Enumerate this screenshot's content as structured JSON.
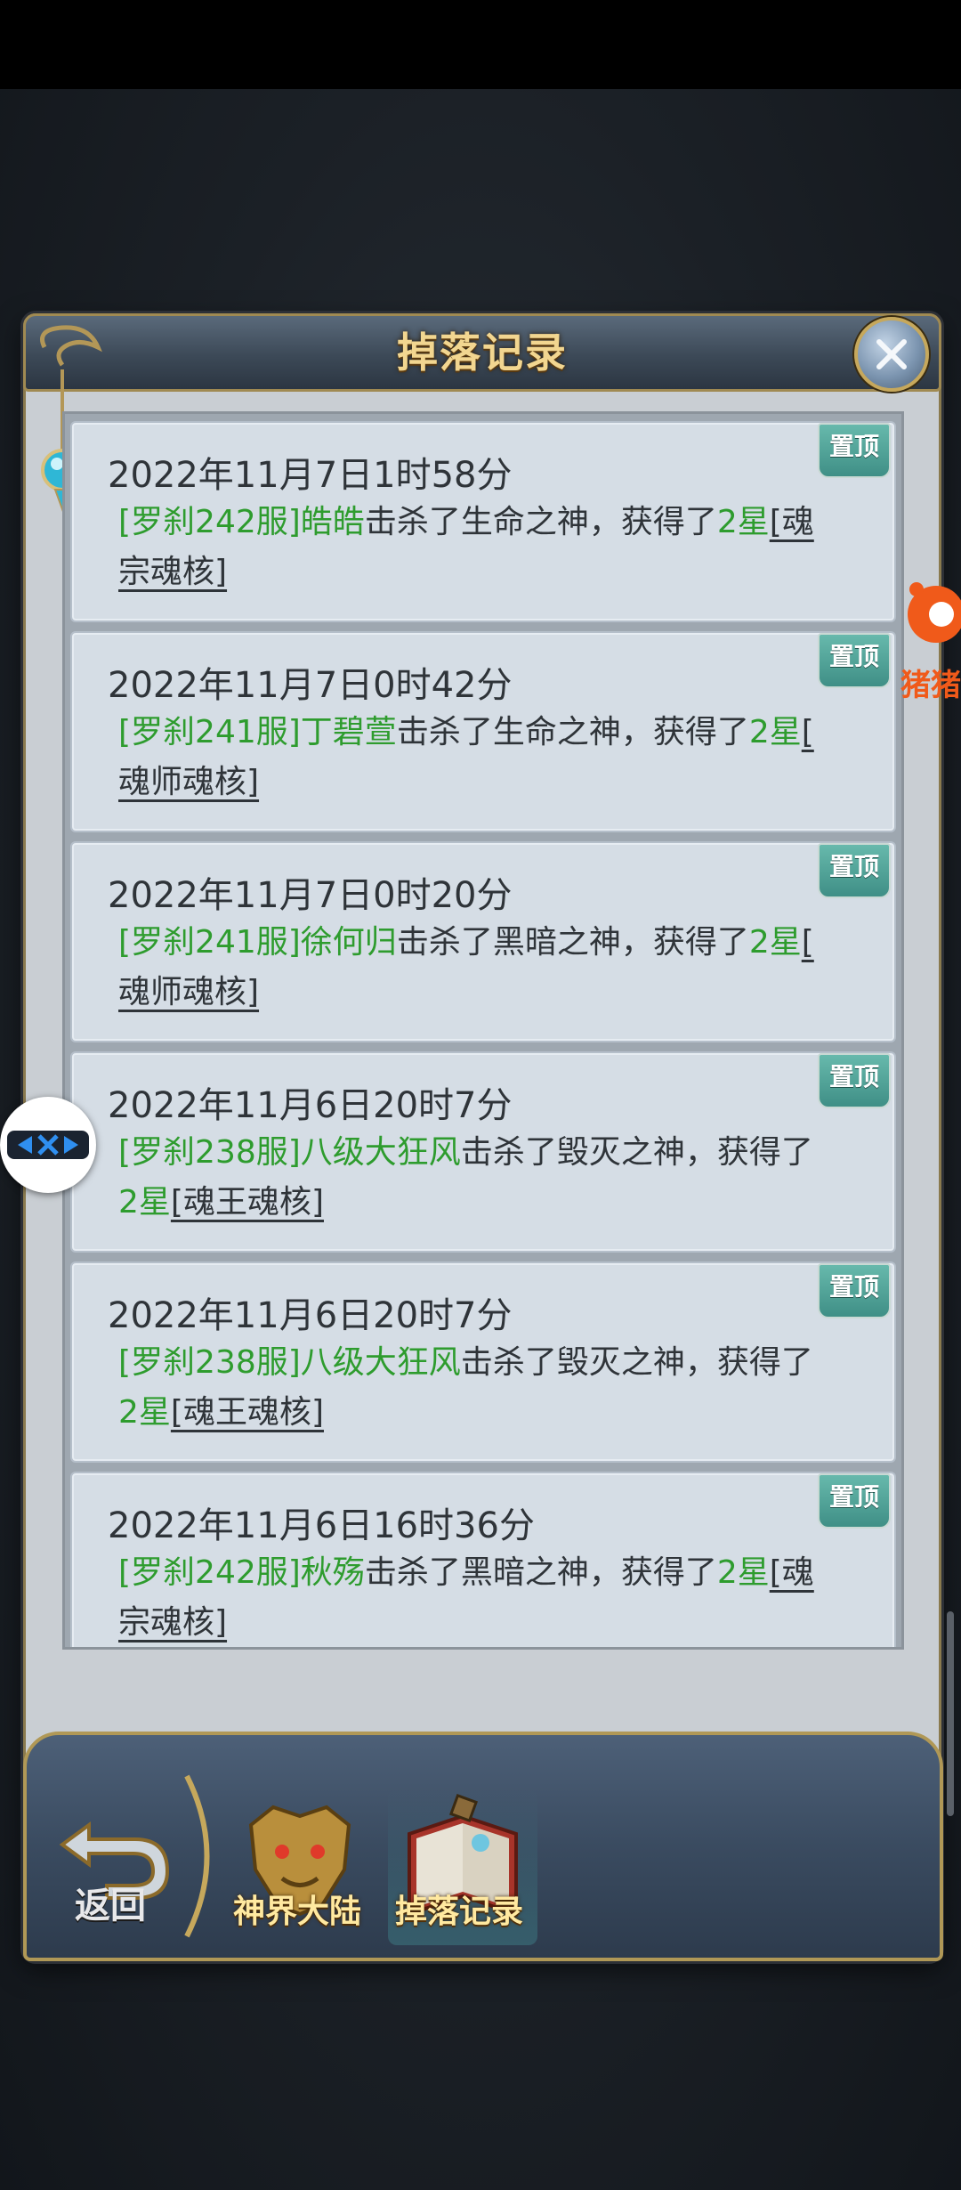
{
  "window": {
    "title": "掉落记录"
  },
  "pin_label": "置顶",
  "records": [
    {
      "date": "2022年11月7日1时58分",
      "player": "[罗刹242服]皓皓",
      "action": "击杀了生命之神，获得了",
      "star": "2星",
      "item_part1": "[魂",
      "item_part2": "宗魂核]"
    },
    {
      "date": "2022年11月7日0时42分",
      "player": "[罗刹241服]丁碧萱",
      "action": "击杀了生命之神，获得了",
      "star": "2星",
      "item_part1": "[",
      "item_part2": "魂师魂核]"
    },
    {
      "date": "2022年11月7日0时20分",
      "player": "[罗刹241服]徐何归",
      "action": "击杀了黑暗之神，获得了",
      "star": "2星",
      "item_part1": "[",
      "item_part2": "魂师魂核]"
    },
    {
      "date": "2022年11月6日20时7分",
      "player": "[罗刹238服]八级大狂风",
      "action": "击杀了毁灭之神，获得了",
      "star": "2星",
      "item_part1": "",
      "item_part2": "[魂王魂核]"
    },
    {
      "date": "2022年11月6日20时7分",
      "player": "[罗刹238服]八级大狂风",
      "action": "击杀了毁灭之神，获得了",
      "star": "2星",
      "item_part1": "",
      "item_part2": "[魂王魂核]"
    },
    {
      "date": "2022年11月6日16时36分",
      "player": "[罗刹242服]秋殇",
      "action": "击杀了黑暗之神，获得了",
      "star": "2星",
      "item_part1": "[魂",
      "item_part2": "宗魂核]"
    }
  ],
  "bottom_nav": {
    "back_label": "返回",
    "tab1_label": "神界大陆",
    "tab2_label": "掉落记录"
  },
  "floating_right_text": "猪猪",
  "colors": {
    "player": "#2e9c2e",
    "text": "#2f3439",
    "title": "#f2d690",
    "pin": "#4fa398"
  }
}
